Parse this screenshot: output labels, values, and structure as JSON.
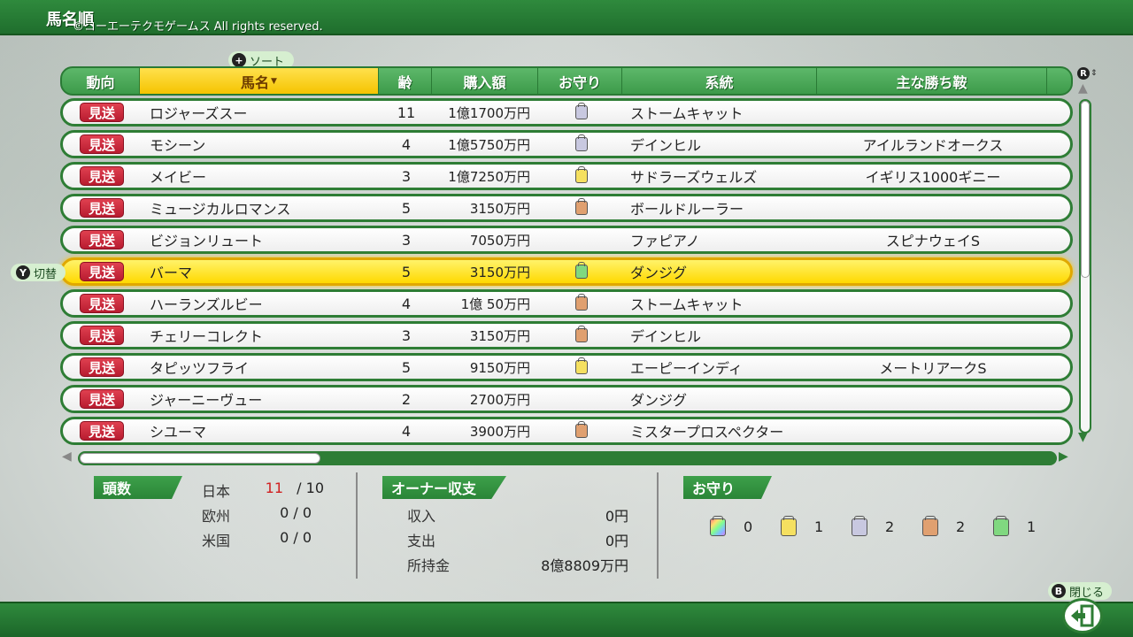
{
  "header": {
    "title": "馬名順",
    "copyright": "©コーエーテクモゲームス All rights reserved."
  },
  "sort_hint": {
    "glyph": "+",
    "label": "ソート"
  },
  "toggle_hint": {
    "glyph": "Y",
    "label": "切替"
  },
  "scroll_glyph": "R",
  "columns": [
    "動向",
    "馬名",
    "齢",
    "購入額",
    "お守り",
    "系統",
    "主な勝ち鞍"
  ],
  "sort_arrow": "▼",
  "rows": [
    {
      "status": "見送",
      "name": "ロジャーズスー",
      "age": "11",
      "price": "1億1700万円",
      "charm": "#c8c8e0",
      "line": "ストームキャット",
      "win": ""
    },
    {
      "status": "見送",
      "name": "モシーン",
      "age": "4",
      "price": "1億5750万円",
      "charm": "#c8c8e0",
      "line": "デインヒル",
      "win": "アイルランドオークス"
    },
    {
      "status": "見送",
      "name": "メイビー",
      "age": "3",
      "price": "1億7250万円",
      "charm": "#f5e060",
      "line": "サドラーズウェルズ",
      "win": "イギリス1000ギニー"
    },
    {
      "status": "見送",
      "name": "ミュージカルロマンス",
      "age": "5",
      "price": "3150万円",
      "charm": "#e0a070",
      "line": "ボールドルーラー",
      "win": ""
    },
    {
      "status": "見送",
      "name": "ビジョンリュート",
      "age": "3",
      "price": "7050万円",
      "charm": "",
      "line": "ファピアノ",
      "win": "スピナウェイS"
    },
    {
      "status": "見送",
      "name": "バーマ",
      "age": "5",
      "price": "3150万円",
      "charm": "#80d880",
      "line": "ダンジグ",
      "win": "",
      "selected": true
    },
    {
      "status": "見送",
      "name": "ハーランズルビー",
      "age": "4",
      "price": "1億 50万円",
      "charm": "#e0a070",
      "line": "ストームキャット",
      "win": ""
    },
    {
      "status": "見送",
      "name": "チェリーコレクト",
      "age": "3",
      "price": "3150万円",
      "charm": "#e0a070",
      "line": "デインヒル",
      "win": ""
    },
    {
      "status": "見送",
      "name": "タピッツフライ",
      "age": "5",
      "price": "9150万円",
      "charm": "#f5e060",
      "line": "エーピーインディ",
      "win": "メートリアークS"
    },
    {
      "status": "見送",
      "name": "ジャーニーヴュー",
      "age": "2",
      "price": "2700万円",
      "charm": "",
      "line": "ダンジグ",
      "win": ""
    },
    {
      "status": "見送",
      "name": "シユーマ",
      "age": "4",
      "price": "3900万円",
      "charm": "#e0a070",
      "line": "ミスタープロスペクター",
      "win": ""
    }
  ],
  "headcount": {
    "tag": "頭数",
    "japan_label": "日本",
    "japan_current": "11",
    "japan_total": "/ 10",
    "europe_label": "欧州",
    "europe_value": "0 / 0",
    "usa_label": "米国",
    "usa_value": "0 / 0"
  },
  "owner": {
    "tag": "オーナー収支",
    "income_label": "収入",
    "income_value": "0円",
    "expense_label": "支出",
    "expense_value": "0円",
    "funds_label": "所持金",
    "funds_value": "8億8809万円"
  },
  "charms": {
    "tag": "お守り",
    "items": [
      {
        "color": "rainbow",
        "count": "0"
      },
      {
        "color": "#f5e060",
        "count": "1"
      },
      {
        "color": "#c8c8e0",
        "count": "2"
      },
      {
        "color": "#e0a070",
        "count": "2"
      },
      {
        "color": "#80d880",
        "count": "1"
      }
    ]
  },
  "close_hint": {
    "glyph": "B",
    "label": "閉じる"
  },
  "colors": {
    "accent_green": "#2e7d35",
    "selected_yellow": "#ffd900",
    "status_red": "#c8283a"
  }
}
